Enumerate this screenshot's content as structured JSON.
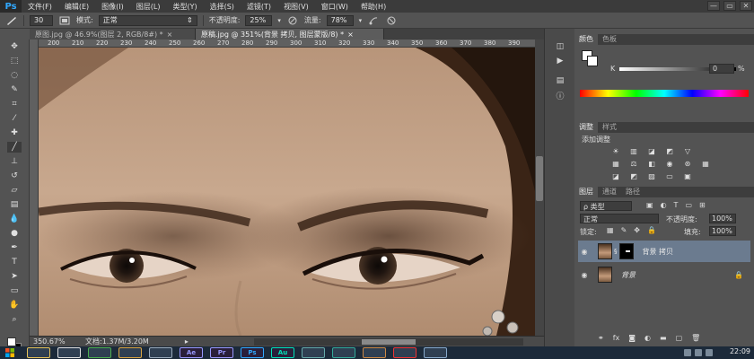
{
  "app": {
    "logo": "Ps"
  },
  "menu": [
    "文件(F)",
    "编辑(E)",
    "图像(I)",
    "图层(L)",
    "类型(Y)",
    "选择(S)",
    "滤镜(T)",
    "视图(V)",
    "窗口(W)",
    "帮助(H)"
  ],
  "window_controls": {
    "minimize": "—",
    "restore": "▭",
    "close": "✕"
  },
  "options": {
    "brush_size": "30",
    "mode_label": "模式:",
    "mode_value": "正常",
    "opacity_label": "不透明度:",
    "opacity_value": "25%",
    "flow_label": "流量:",
    "flow_value": "78%"
  },
  "tabs": [
    {
      "label": "原图.jpg @ 46.9%(图层 2, RGB/8#) *",
      "close": "×"
    },
    {
      "label": "原稿.jpg @ 351%(背景 拷贝, 图层蒙版/8) *",
      "close": "×"
    }
  ],
  "ruler": {
    "ticks": [
      "200",
      "210",
      "220",
      "230",
      "240",
      "250",
      "260",
      "270",
      "280",
      "290",
      "300",
      "310",
      "320",
      "330",
      "340",
      "350",
      "360",
      "370",
      "380",
      "390",
      "400"
    ]
  },
  "tools": [
    "move-tool",
    "marquee-tool",
    "lasso-tool",
    "quick-select-tool",
    "crop-tool",
    "eyedropper-tool",
    "healing-tool",
    "brush-tool",
    "clone-stamp-tool",
    "history-brush-tool",
    "eraser-tool",
    "gradient-tool",
    "blur-tool",
    "dodge-tool",
    "pen-tool",
    "type-tool",
    "path-select-tool",
    "shape-tool",
    "hand-tool",
    "zoom-tool"
  ],
  "status": {
    "zoom": "350.67%",
    "doc_info": "文档:1.37M/3.20M",
    "arrow": "▸"
  },
  "color_panel": {
    "tabs": [
      "颜色",
      "色板"
    ],
    "k_label": "K",
    "k_value": "0",
    "k_unit": "%"
  },
  "adjustments_panel": {
    "tabs": [
      "调整",
      "样式"
    ],
    "heading": "添加调整"
  },
  "layers_panel": {
    "tabs": [
      "图层",
      "通道",
      "路径"
    ],
    "filter_label": "ρ 类型",
    "blend_mode": "正常",
    "opacity_label": "不透明度:",
    "opacity_value": "100%",
    "lock_label": "锁定:",
    "fill_label": "填充:",
    "fill_value": "100%",
    "layers": [
      {
        "name": "背景 拷贝",
        "selected": true
      },
      {
        "name": "背景",
        "selected": false
      }
    ],
    "footer_icons": [
      "link-icon",
      "fx-icon",
      "mask-icon",
      "adjust-icon",
      "folder-icon",
      "new-layer-icon",
      "trash-icon"
    ]
  },
  "taskbar": {
    "apps": [
      {
        "name": "explorer",
        "label": "",
        "color": "#e8c45a"
      },
      {
        "name": "media-player",
        "label": "",
        "color": "#e0e0e0"
      },
      {
        "name": "chrome",
        "label": "",
        "color": "#4caf50"
      },
      {
        "name": "folder",
        "label": "",
        "color": "#d9a441"
      },
      {
        "name": "settings",
        "label": "",
        "color": "#9ab"
      },
      {
        "name": "after-effects",
        "label": "Ae",
        "color": "#9999ff"
      },
      {
        "name": "premiere",
        "label": "Pr",
        "color": "#9999ff"
      },
      {
        "name": "photoshop",
        "label": "Ps",
        "color": "#31a8ff"
      },
      {
        "name": "audition",
        "label": "Au",
        "color": "#00e4bb"
      },
      {
        "name": "media-encoder",
        "label": "",
        "color": "#6aa"
      },
      {
        "name": "browser",
        "label": "",
        "color": "#3a9"
      },
      {
        "name": "archive",
        "label": "",
        "color": "#c84"
      },
      {
        "name": "flash",
        "label": "",
        "color": "#e33"
      },
      {
        "name": "window",
        "label": "",
        "color": "#8ac"
      }
    ],
    "clock": "22:09"
  }
}
